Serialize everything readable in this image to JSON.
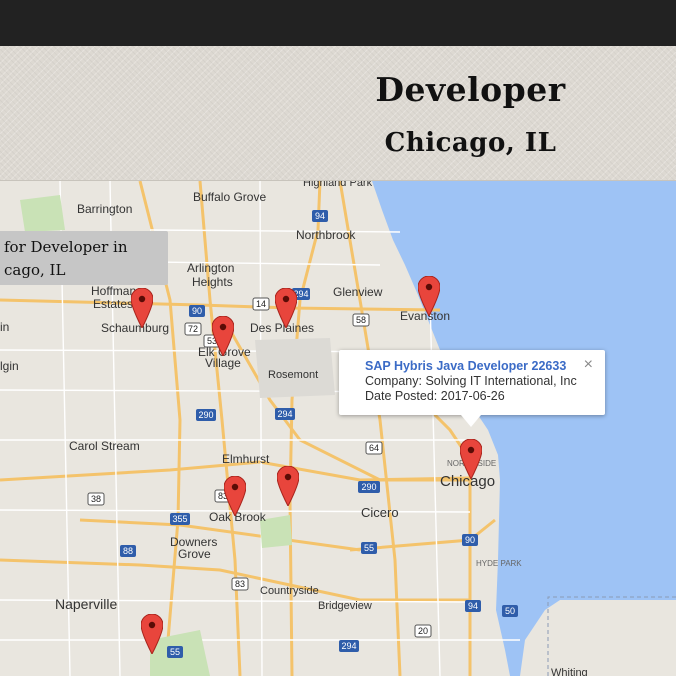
{
  "header": {
    "title": "Developer",
    "location": "Chicago, IL"
  },
  "search_box": {
    "line1": "for Developer in",
    "line2": "cago, IL"
  },
  "info_window": {
    "job_title": "SAP Hybris Java Developer 22633",
    "company": "Company: Solving IT International, Inc",
    "date_posted": "Date Posted: 2017-06-26",
    "close_symbol": "×"
  },
  "map": {
    "water_color": "#9ec3f5",
    "land_color": "#e9e6df",
    "marker_color": "#e8453c",
    "places": {
      "barrington": "Barrington",
      "buffalo_grove": "Buffalo Grove",
      "highland_park": "Highland Park",
      "northbrook": "Northbrook",
      "arlington_heights_1": "Arlington",
      "arlington_heights_2": "Heights",
      "hoffman_estates_1": "Hoffman",
      "hoffman_estates_2": "Estates",
      "schaumburg": "Schaumburg",
      "glenview": "Glenview",
      "evanston": "Evanston",
      "des_plaines": "Des Plaines",
      "elk_grove_1": "Elk Grove",
      "elk_grove_2": "Village",
      "rosemont": "Rosemont",
      "elgin": "lgin",
      "in": "in",
      "carol_stream": "Carol Stream",
      "elmhurst": "Elmhurst",
      "chicago": "Chicago",
      "north_side": "NORTH SIDE",
      "oak_brook": "Oak Brook",
      "cicero": "Cicero",
      "downers_grove_1": "Downers",
      "downers_grove_2": "Grove",
      "hyde_park": "HYDE PARK",
      "countryside": "Countryside",
      "naperville": "Naperville",
      "bridgeview": "Bridgeview",
      "whiting": "Whiting"
    },
    "shields": {
      "i94_north": "94",
      "i90_west": "90",
      "us14": "14",
      "i294_north": "294",
      "r58": "58",
      "r72": "72",
      "r53": "53",
      "i290": "290",
      "i294_mid": "294",
      "r64": "64",
      "i90_east": "90",
      "r38": "38",
      "i355": "355",
      "r83a": "83",
      "i290_east": "290",
      "i55": "55",
      "r88": "88",
      "r83b": "83",
      "i90_south": "90",
      "i94_south": "94",
      "r50": "50",
      "us20": "20",
      "i294_south": "294",
      "i55_south": "55"
    }
  }
}
